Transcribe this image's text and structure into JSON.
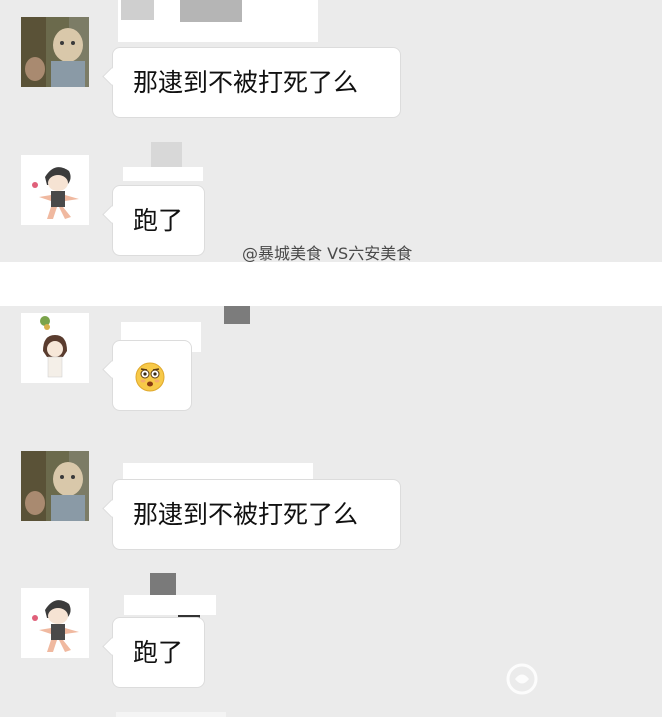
{
  "panel1": {
    "messages": [
      {
        "text": "那逮到不被打死了么",
        "avatar": "baby-photo"
      },
      {
        "text": "跑了",
        "avatar": "cartoon-boy"
      }
    ],
    "watermark": "@暴城美食 VS六安美食"
  },
  "panel2": {
    "messages": [
      {
        "text": "",
        "avatar": "cartoon-girl",
        "emoji": "shocked-face-emoji"
      },
      {
        "text": "那逮到不被打死了么",
        "avatar": "baby-photo"
      },
      {
        "text": "跑了",
        "avatar": "cartoon-boy"
      }
    ]
  },
  "colors": {
    "background": "#ebebeb",
    "bubble": "#ffffff",
    "separator": "#ffffff"
  }
}
